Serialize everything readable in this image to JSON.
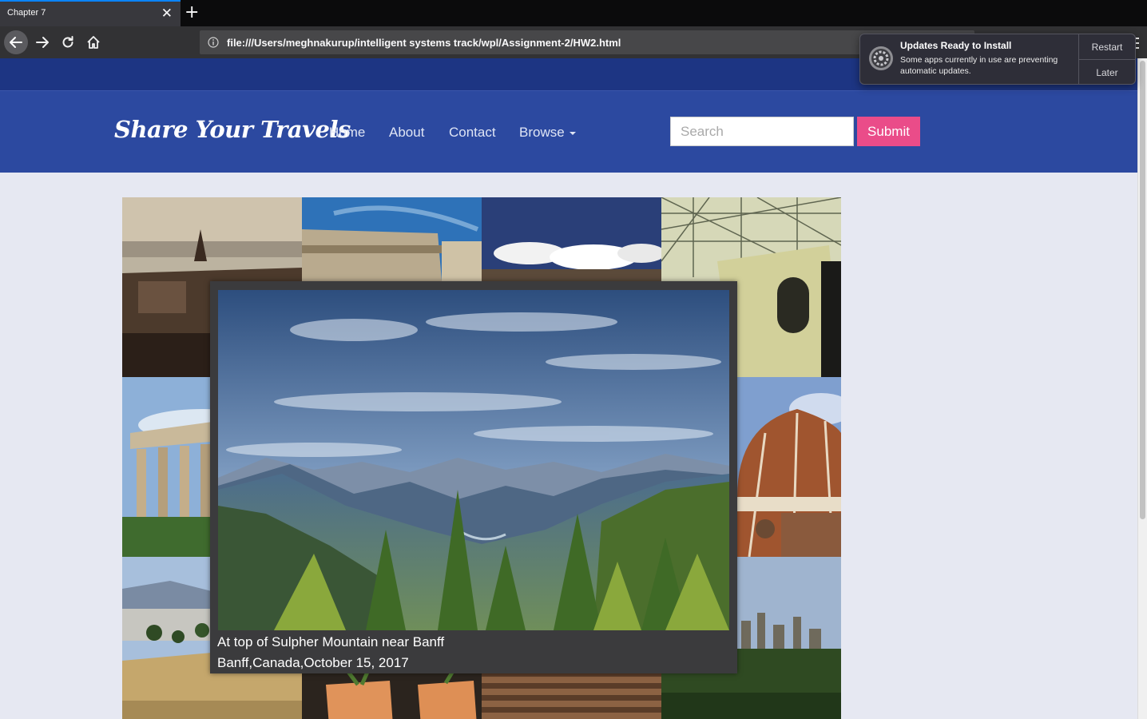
{
  "browser": {
    "tab_title": "Chapter 7",
    "tab_close": "✕",
    "new_tab": "+",
    "url": "file:///Users/meghnakurup/intelligent systems track/wpl/Assignment-2/HW2.html"
  },
  "site": {
    "logo": "Share Your Travels",
    "nav": [
      "Home",
      "About",
      "Contact",
      "Browse"
    ],
    "search_placeholder": "Search",
    "submit_label": "Submit"
  },
  "gallery": {
    "tiles": [
      {
        "name": "city-river-view"
      },
      {
        "name": "roman-arch"
      },
      {
        "name": "village-clouds"
      },
      {
        "name": "museum-glass-roof"
      },
      {
        "name": "greek-temple"
      },
      {
        "name": "mountain-banff"
      },
      {
        "name": "mountain-banff"
      },
      {
        "name": "florence-dome"
      },
      {
        "name": "greek-hillside"
      },
      {
        "name": "potted-plants"
      },
      {
        "name": "stone-stairs"
      },
      {
        "name": "city-skyline"
      }
    ]
  },
  "lightbox": {
    "title": "At top of Sulpher Mountain near Banff",
    "meta": "Banff,Canada,October 15, 2017"
  },
  "notification": {
    "title": "Updates Ready to Install",
    "body": "Some apps currently in use are preventing automatic updates.",
    "actions": [
      "Restart",
      "Later"
    ]
  },
  "colors": {
    "header": "#2c49a0",
    "strip": "#1d3583",
    "submit": "#ea4c89",
    "page_bg": "#e6e8f2"
  }
}
